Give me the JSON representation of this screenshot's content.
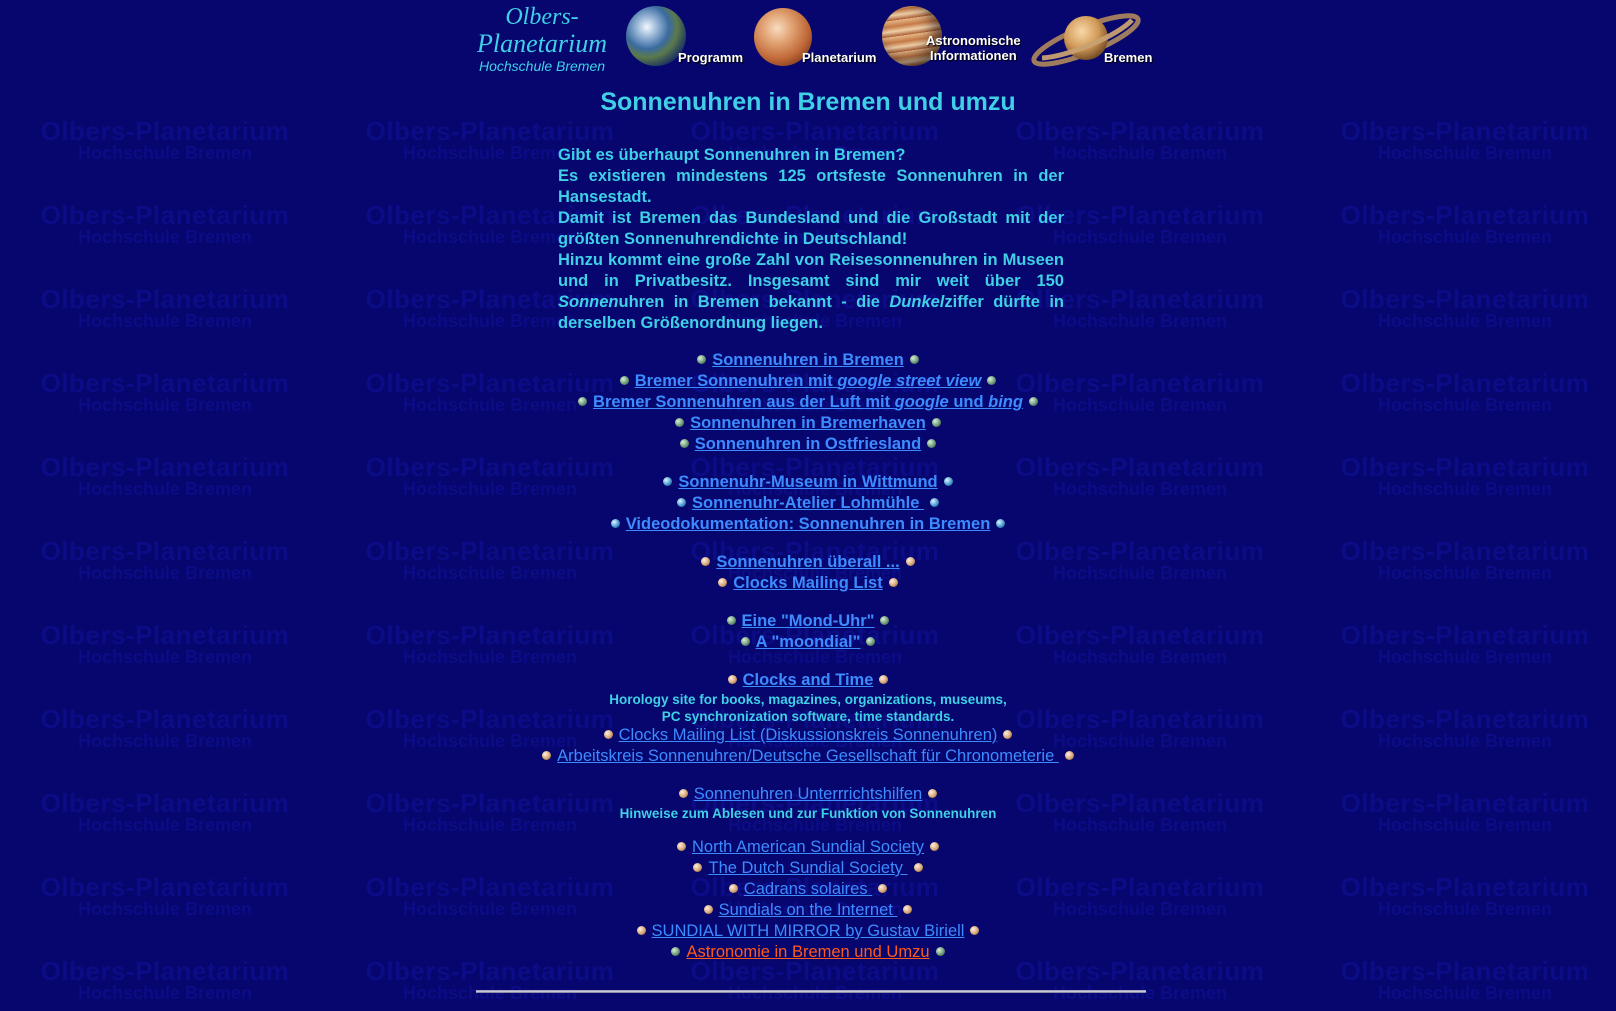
{
  "watermark": {
    "line1": "Olbers-Planetarium",
    "line2": "Hochschule Bremen"
  },
  "header": {
    "logo": {
      "line1": "Olbers-",
      "line2": "Planetarium",
      "line3": "Hochschule Bremen"
    },
    "nav": [
      {
        "label": "Programm",
        "icon": "earth-icon"
      },
      {
        "label": "Planetarium",
        "icon": "mars-icon"
      },
      {
        "label_line1": "Astronomische",
        "label_line2": "Informationen",
        "icon": "jupiter-icon"
      },
      {
        "label": "Bremen",
        "icon": "saturn-icon"
      }
    ]
  },
  "page_title": "Sonnenuhren in Bremen und umzu",
  "intro": {
    "p1": "Gibt es überhaupt Sonnenuhren in Bremen?",
    "p2": "Es existieren mindestens 125 ortsfeste Sonnenuhren in der Hansestadt.",
    "p3": "Damit ist Bremen das Bundesland und die Großstadt mit der größten Sonnenuhrendichte in Deutschland!",
    "p4a": "Hinzu kommt eine große Zahl von Reisesonnenuhren in Museen und in Privatbesitz. Insgesamt sind mir weit über 150 ",
    "p4b": "Sonnen",
    "p4c": "uhren in Bremen bekannt - die ",
    "p4d": "Dunkel",
    "p4e": "ziffer dürfte in derselben Größenordnung liegen."
  },
  "links": {
    "l1": "Sonnenuhren in Bremen",
    "l2a": "Bremer Sonnenuhren mit ",
    "l2b": "google street view",
    "l3a": "Bremer Sonnenuhren aus der Luft mit ",
    "l3b": "google",
    "l3c": " und ",
    "l3d": "bing",
    "l4": "Sonnenuhren in Bremerhaven",
    "l5": "Sonnenuhren in Ostfriesland",
    "l6": "Sonnenuhr-Museum in Wittmund",
    "l7": "Sonnenuhr-Atelier Lohmühle ",
    "l8": "Videodokumentation: Sonnenuhren in Bremen",
    "l9": "Sonnenuhren überall ...",
    "l10": "Clocks Mailing List",
    "l11": "Eine \"Mond-Uhr\"",
    "l12": "A \"moondial\"",
    "l13": "Clocks and Time",
    "l13_note1": "Horology site for books, magazines, organizations, museums,",
    "l13_note2": "PC synchronization software, time standards.",
    "l14": "Clocks Mailing List (Diskussionskreis Sonnenuhren)",
    "l15": "Arbeitskreis Sonnenuhren/Deutsche Gesellschaft für Chronometerie ",
    "l16": "Sonnenuhren Unterrrichtshilfen",
    "l16_note": "Hinweise zum Ablesen und zur Funktion von Sonnenuhren",
    "l17": "North American Sundial Society",
    "l18": "The Dutch Sundial Society ",
    "l19": "Cadrans solaires ",
    "l20": "Sundials on the Internet ",
    "l21": "SUNDIAL WITH MIRROR by Gustav Biriell",
    "l22": "Astronomie in Bremen und Umzu"
  },
  "colors": {
    "background": "#06066e",
    "text": "#3fd0e6",
    "link": "#3d8cff",
    "visited_link": "#ff5a1a"
  }
}
